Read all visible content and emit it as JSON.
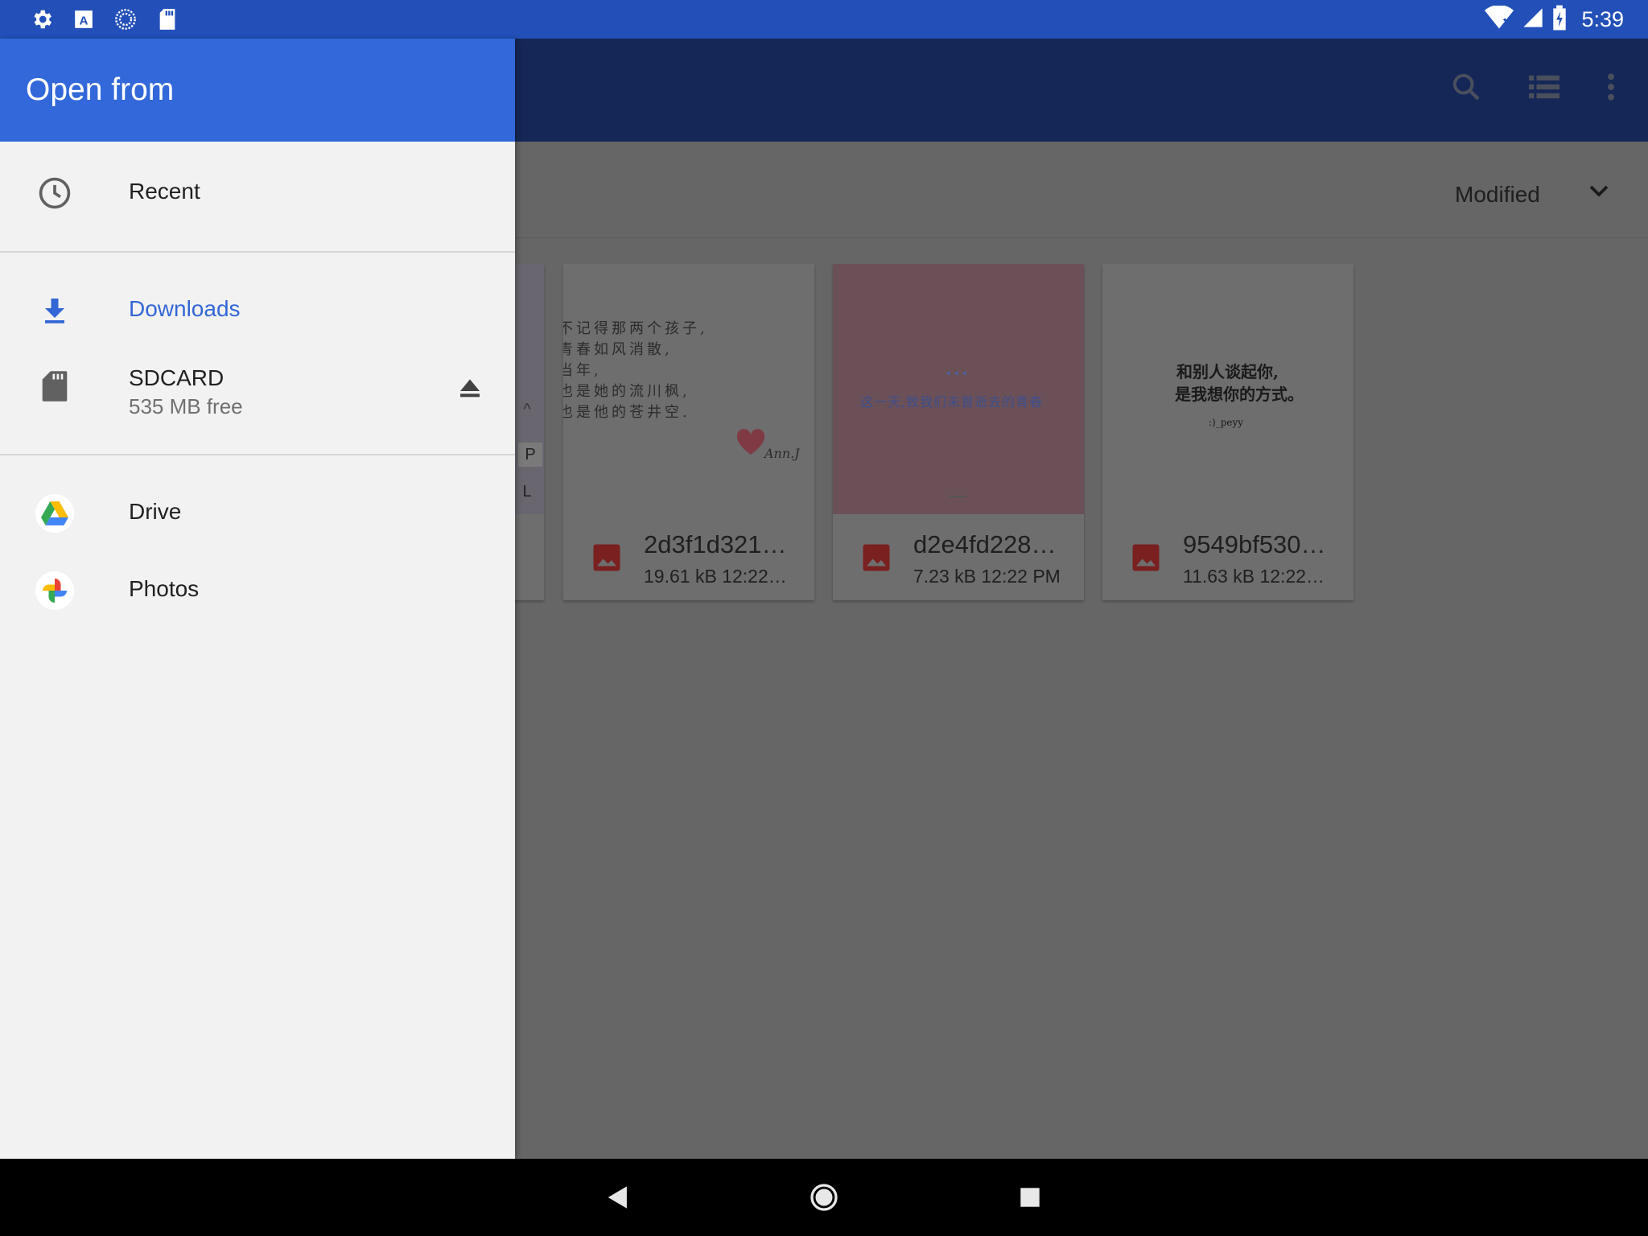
{
  "status_bar": {
    "time": "5:39",
    "left_icons": [
      "settings-icon",
      "text-icon",
      "sync-icon",
      "sdcard-icon"
    ],
    "right_icons": [
      "wifi-icon",
      "signal-icon",
      "battery-icon"
    ]
  },
  "app_bar": {
    "actions": [
      "search-icon",
      "list-view-icon",
      "more-vert-icon"
    ]
  },
  "sort": {
    "label": "Modified"
  },
  "files": [
    {
      "name": "2d3f1d321…",
      "info": "19.61 kB  12:22…",
      "thumb_lines": [
        "不记得那两个孩子,",
        "青春如风消散,",
        "当年,",
        "也是她的流川枫,",
        "也是他的苍井空."
      ],
      "thumb_signature": "Ann.J"
    },
    {
      "name": "d2e4fd228…",
      "info": "7.23 kB  12:22 PM",
      "thumb_lines": [
        "这一天,致我们未曾逝去的青春"
      ]
    },
    {
      "name": "9549bf530…",
      "info": "11.63 kB  12:22…",
      "thumb_lines": [
        "和别人谈起你,",
        "是我想你的方式。",
        ":)_peyy"
      ]
    }
  ],
  "partial_card": {
    "keys": [
      "^",
      "P",
      "L"
    ]
  },
  "drawer": {
    "title": "Open from",
    "items": [
      {
        "label": "Recent",
        "icon": "clock-icon"
      },
      {
        "label": "Downloads",
        "icon": "download-icon",
        "active": true
      },
      {
        "label": "SDCARD",
        "sub": "535 MB free",
        "icon": "sdcard-icon",
        "action_icon": "eject-icon"
      },
      {
        "label": "Drive",
        "icon": "drive-icon"
      },
      {
        "label": "Photos",
        "icon": "photos-icon"
      }
    ]
  },
  "nav_bar": {
    "buttons": [
      "back-icon",
      "home-icon",
      "recents-icon"
    ]
  },
  "colors": {
    "status_bar": "#2250b8",
    "drawer_header": "#3268d9",
    "active_accent": "#3367d6",
    "scrim": "#666666"
  }
}
